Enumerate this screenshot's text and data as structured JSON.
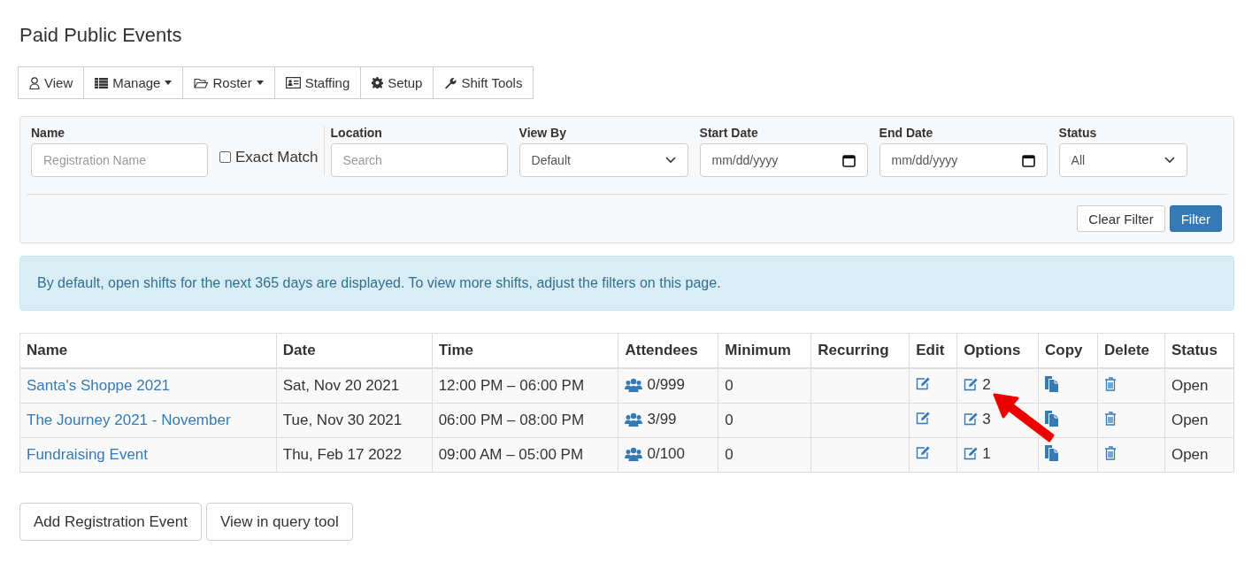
{
  "page_title": "Paid Public Events",
  "toolbar": [
    {
      "label": "View",
      "dropdown": false
    },
    {
      "label": "Manage",
      "dropdown": true
    },
    {
      "label": "Roster",
      "dropdown": true
    },
    {
      "label": "Staffing",
      "dropdown": false
    },
    {
      "label": "Setup",
      "dropdown": false
    },
    {
      "label": "Shift Tools",
      "dropdown": false
    }
  ],
  "filter": {
    "name": {
      "label": "Name",
      "placeholder": "Registration Name"
    },
    "exact_match": {
      "label": "Exact Match",
      "checked": false
    },
    "location": {
      "label": "Location",
      "placeholder": "Search"
    },
    "view_by": {
      "label": "View By",
      "value": "Default"
    },
    "start_date": {
      "label": "Start Date",
      "placeholder": "mm/dd/yyyy"
    },
    "end_date": {
      "label": "End Date",
      "placeholder": "mm/dd/yyyy"
    },
    "status": {
      "label": "Status",
      "value": "All"
    },
    "buttons": [
      "Clear Filter",
      "Filter"
    ]
  },
  "alert": "By default, open shifts for the next 365 days are displayed. To view more shifts, adjust the filters on this page.",
  "table": {
    "columns": [
      "Name",
      "Date",
      "Time",
      "Attendees",
      "Minimum",
      "Recurring",
      "Edit",
      "Options",
      "Copy",
      "Delete",
      "Status"
    ],
    "rows": [
      {
        "name": "Santa's Shoppe 2021",
        "date": "Sat, Nov 20 2021",
        "time": "12:00 PM – 06:00 PM",
        "attendees": "0/999",
        "minimum": "0",
        "options": "2",
        "status": "Open"
      },
      {
        "name": "The Journey 2021 - November",
        "date": "Tue, Nov 30 2021",
        "time": "06:00 PM – 08:00 PM",
        "attendees": "3/99",
        "minimum": "0",
        "options": "3",
        "status": "Open"
      },
      {
        "name": "Fundraising Event",
        "date": "Thu, Feb 17 2022",
        "time": "09:00 AM – 05:00 PM",
        "attendees": "0/100",
        "minimum": "0",
        "options": "1",
        "status": "Open"
      }
    ]
  },
  "buttons": [
    "Add Registration Event",
    "View in query tool"
  ]
}
